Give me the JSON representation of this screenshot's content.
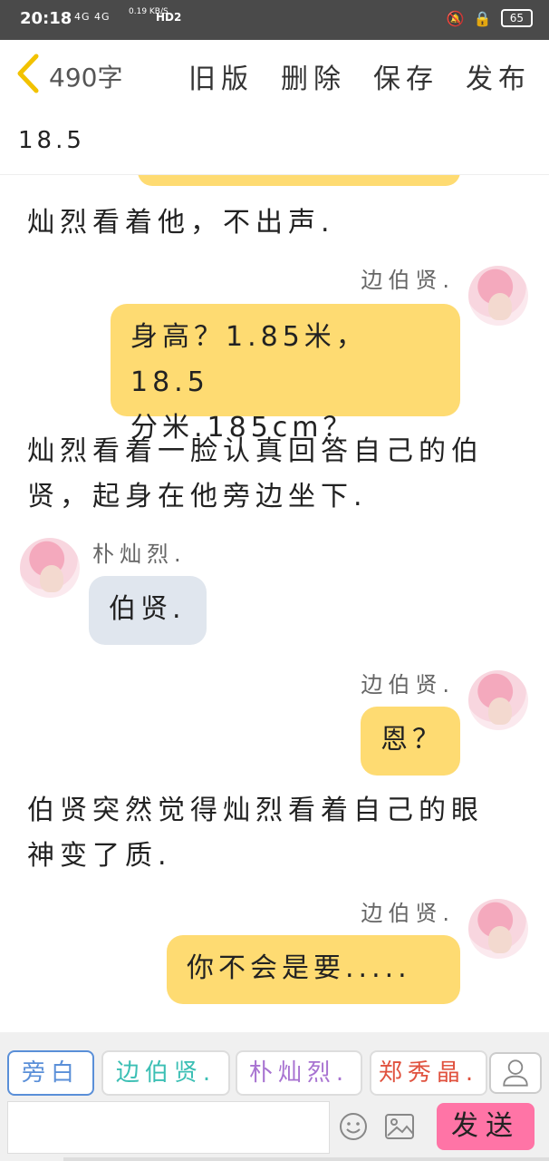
{
  "statusbar": {
    "time": "20:18",
    "network": "4G 4G",
    "speed": "0.19 KB/S",
    "hd": "HD2",
    "battery": "65"
  },
  "topbar": {
    "word_count": "490字",
    "old_version": "旧版",
    "delete": "删除",
    "save": "保存",
    "publish": "发布"
  },
  "subtitle": "18.5",
  "chat": {
    "narration_1": "灿烈看着他，不出声.",
    "msg_1": {
      "speaker": "边伯贤.",
      "lines": [
        "身高？1.85米，18.5",
        "分米.185cm？"
      ]
    },
    "narration_2": [
      "灿烈看着一脸认真回答自己的伯",
      "贤，起身在他旁边坐下."
    ],
    "msg_2": {
      "speaker": "朴灿烈.",
      "text": "伯贤."
    },
    "msg_3": {
      "speaker": "边伯贤.",
      "text": "恩？"
    },
    "narration_3": [
      "伯贤突然觉得灿烈看着自己的眼",
      "神变了质."
    ],
    "msg_4": {
      "speaker": "边伯贤.",
      "text": "你不会是要....."
    }
  },
  "roles": [
    {
      "label": "旁白",
      "color": "#5a8fd8"
    },
    {
      "label": "边伯贤.",
      "color": "#3bbfb4"
    },
    {
      "label": "朴灿烈.",
      "color": "#a873d1"
    },
    {
      "label": "郑秀晶.",
      "color": "#e0523f"
    }
  ],
  "send_label": "发送"
}
